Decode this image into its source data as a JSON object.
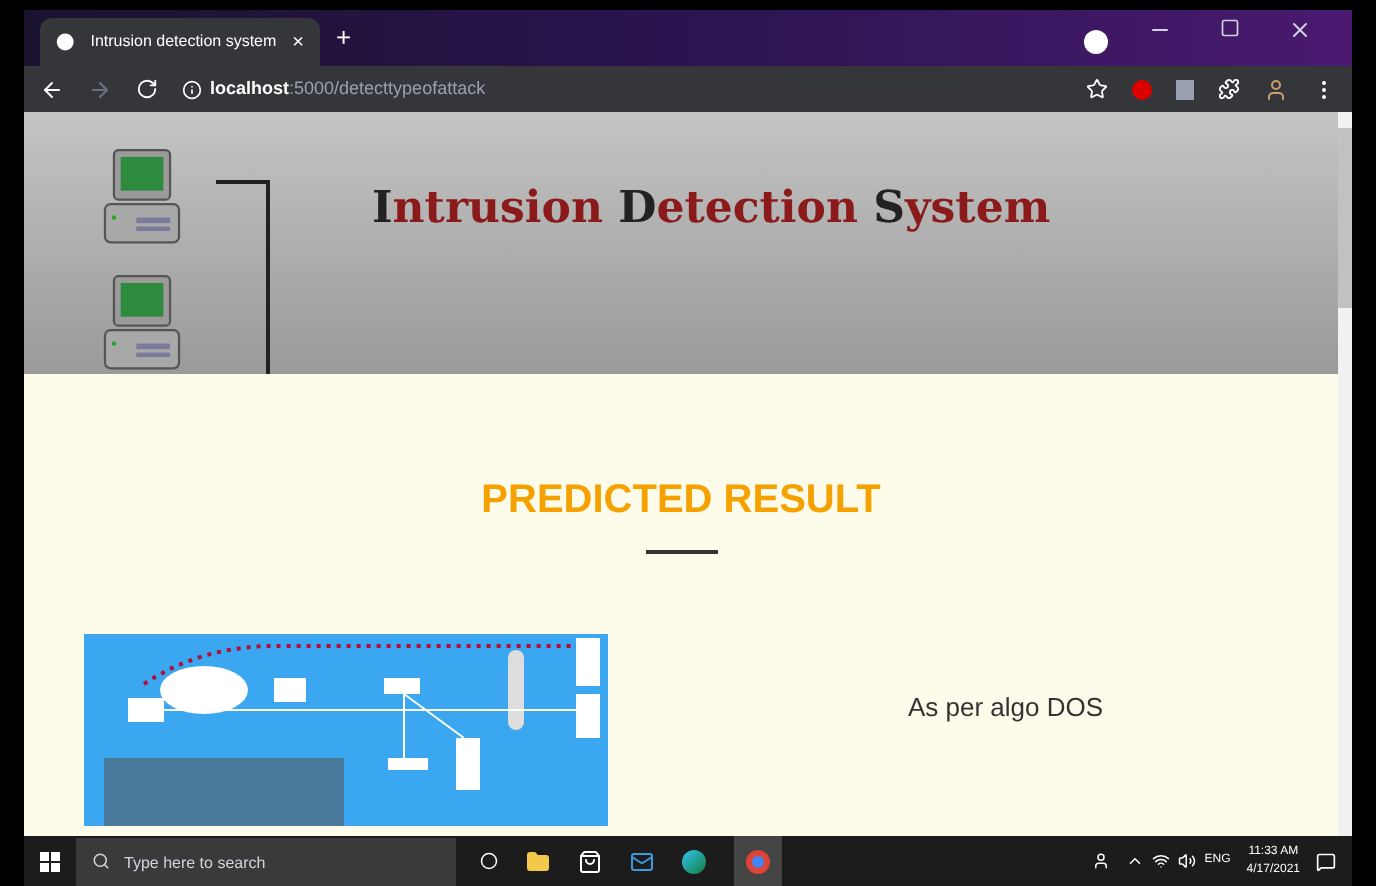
{
  "browser": {
    "tab": {
      "title": "Intrusion detection system",
      "close": "×",
      "selected": true
    },
    "new_tab": "+",
    "address": {
      "host": "localhost",
      "path": ":5000/detecttypeofattack"
    }
  },
  "header": {
    "title": [
      "Intrusion",
      "Detection",
      "System"
    ]
  },
  "result": {
    "heading": "PREDICTED RESULT",
    "text": "As per algo DOS"
  },
  "taskbar": {
    "search_placeholder": "Type here to search",
    "language": "ENG",
    "time": "11:33 AM",
    "date": "4/17/2021"
  }
}
